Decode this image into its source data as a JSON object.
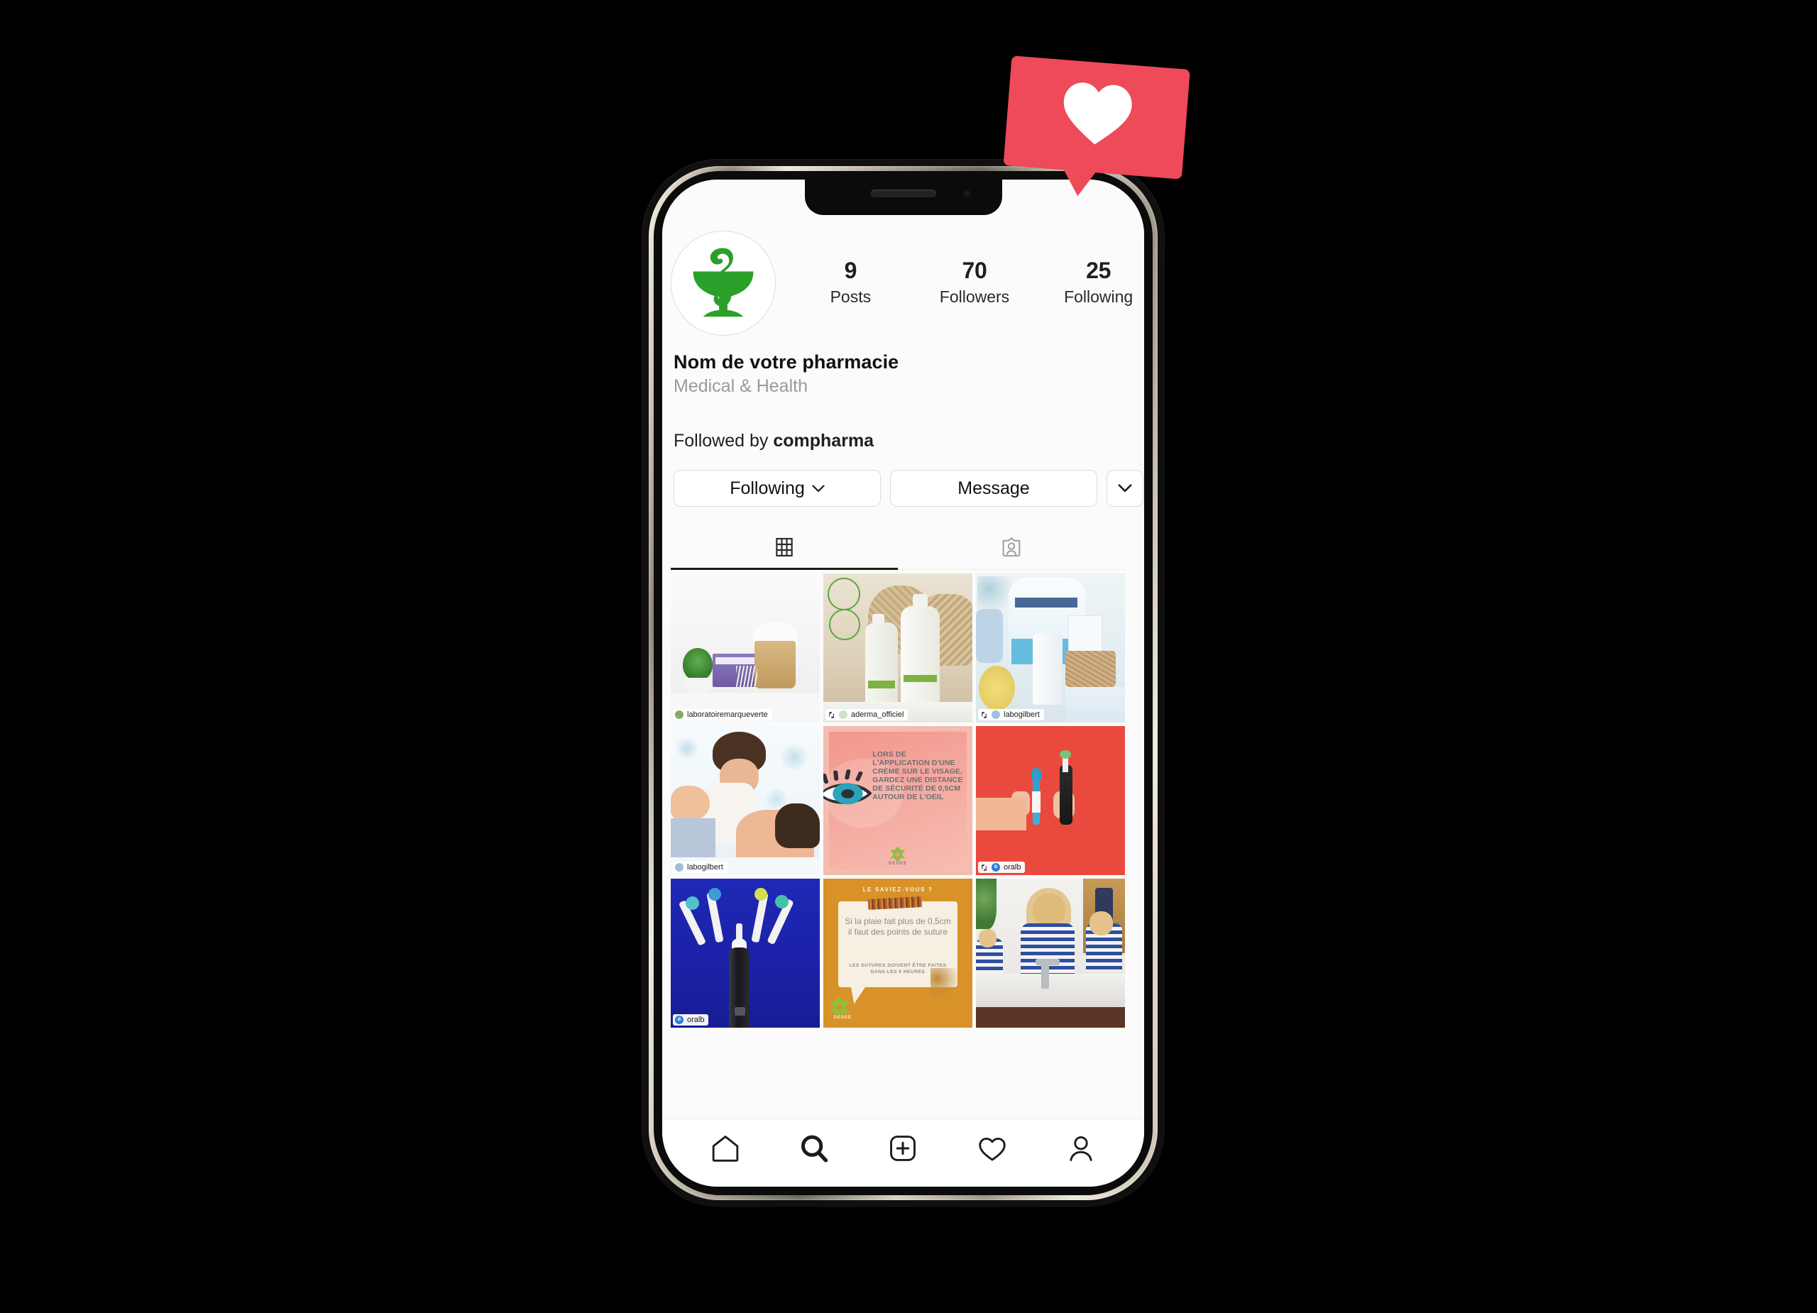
{
  "badge": {
    "name": "like-notification-badge",
    "icon": "heart-icon",
    "color": "#ee4a59"
  },
  "device": {
    "name": "smartphone-mockup",
    "notch_icons": [
      "speaker-slot",
      "front-camera"
    ]
  },
  "profile": {
    "avatar_icon": "pharmacy-bowl-of-hygieia-icon",
    "name": "Nom de votre pharmacie",
    "category": "Medical & Health",
    "followed_by_prefix": "Followed by ",
    "followed_by_user": "compharma",
    "stats": [
      {
        "value": "9",
        "label": "Posts"
      },
      {
        "value": "70",
        "label": "Followers"
      },
      {
        "value": "25",
        "label": "Following"
      }
    ]
  },
  "actions": {
    "following_label": "Following",
    "following_caret_icon": "chevron-down-icon",
    "message_label": "Message",
    "more_icon": "chevron-down-icon"
  },
  "tabs": [
    {
      "icon": "grid-icon",
      "name": "tab-posts-grid",
      "active": true
    },
    {
      "icon": "person-tagged-icon",
      "name": "tab-tagged",
      "active": false
    }
  ],
  "grid": [
    {
      "name": "post-cotton-buds",
      "credit": "laboratoiremarqueverte",
      "has_repost_icon": false,
      "has_avatar": true,
      "alt": "Cotton buds box and cotton wool in a wooden tub"
    },
    {
      "name": "post-aderma-bottles",
      "credit": "aderma_officiel",
      "has_repost_icon": true,
      "has_avatar": true,
      "alt": "Two A-DERMA shower gel bottles in front of woven baskets"
    },
    {
      "name": "post-pads-bio",
      "credit": "labogilbert",
      "has_repost_icon": true,
      "has_avatar": true,
      "alt": "PADS BIO cotton pads with Cold Cream tube and basket"
    },
    {
      "name": "post-baby-and-dad",
      "credit": "labogilbert",
      "has_repost_icon": false,
      "has_avatar": true,
      "alt": "Laughing baby lying on a father on a floral bedsheet"
    },
    {
      "name": "post-eye-safety-tip",
      "credit": "",
      "has_repost_icon": false,
      "has_avatar": false,
      "poster_text": "LORS DE L'APPLICATION D'UNE CRÈME SUR LE VISAGE, GARDEZ UNE DISTANCE DE SÉCURITÉ DE 0,5CM AUTOUR DE L'OEIL",
      "poster_brand": "DEGEE",
      "alt": "Pink graphic with a large eye illustration and advice text"
    },
    {
      "name": "post-toothbrush-hands",
      "credit": "oralb",
      "has_repost_icon": true,
      "has_avatar": true,
      "alt": "Two hands holding a manual and an electric toothbrush on red"
    },
    {
      "name": "post-oralb-brush-heads",
      "credit": "oralb",
      "has_repost_icon": false,
      "has_avatar": true,
      "alt": "Electric toothbrush with four replacement heads on blue"
    },
    {
      "name": "post-suture-tip",
      "credit": "",
      "has_repost_icon": false,
      "has_avatar": false,
      "poster_kicker": "LE SAVIEZ-VOUS ?",
      "poster_text": "Si la plaie fait plus de 0,5cm il faut des points de suture",
      "poster_subtext": "LES SUTURES DOIVENT ÊTRE FAITES DANS LES 6 HEURES",
      "poster_brand": "DEGEE",
      "alt": "Orange graphic with a speech bubble giving first-aid advice"
    },
    {
      "name": "post-family-brushing",
      "credit": "",
      "has_repost_icon": false,
      "has_avatar": false,
      "alt": "Mother and daughter brushing teeth at a bathroom mirror"
    }
  ],
  "bottom_nav": [
    {
      "icon": "home-icon",
      "name": "nav-home"
    },
    {
      "icon": "search-icon",
      "name": "nav-search"
    },
    {
      "icon": "plus-square-icon",
      "name": "nav-create"
    },
    {
      "icon": "heart-icon",
      "name": "nav-activity"
    },
    {
      "icon": "person-icon",
      "name": "nav-profile"
    }
  ]
}
